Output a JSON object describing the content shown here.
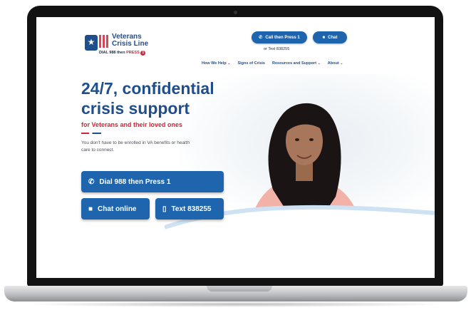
{
  "header": {
    "logo": {
      "line1": "Veterans",
      "line2": "Crisis Line",
      "dial_prefix": "DIAL 988 then",
      "dial_press": "PRESS",
      "dial_number": "1"
    },
    "call_button": "Call then Press 1",
    "chat_button": "Chat",
    "or_text": "or Text 838255"
  },
  "nav": {
    "items": [
      {
        "label": "How We Help",
        "has_caret": true
      },
      {
        "label": "Signs of Crisis",
        "has_caret": false
      },
      {
        "label": "Resources and Support",
        "has_caret": true
      },
      {
        "label": "About",
        "has_caret": true
      }
    ],
    "caret": "⌄"
  },
  "hero": {
    "title_line1": "24/7, confidential",
    "title_line2": "crisis support",
    "subtitle": "for Veterans and their loved ones",
    "blurb_line1": "You don't have to be enrolled in VA benefits or health",
    "blurb_line2": "care to connect.",
    "dial_button": "Dial 988 then Press 1",
    "chat_button": "Chat online",
    "text_button": "Text 838255"
  },
  "icons": {
    "phone": "phone-icon",
    "chat": "chat-icon",
    "mobile": "mobile-phone-icon"
  },
  "colors": {
    "brand_blue": "#1e65ad",
    "heading_blue": "#1f4e8c",
    "accent_red": "#d0263c",
    "bezel": "#121212"
  }
}
